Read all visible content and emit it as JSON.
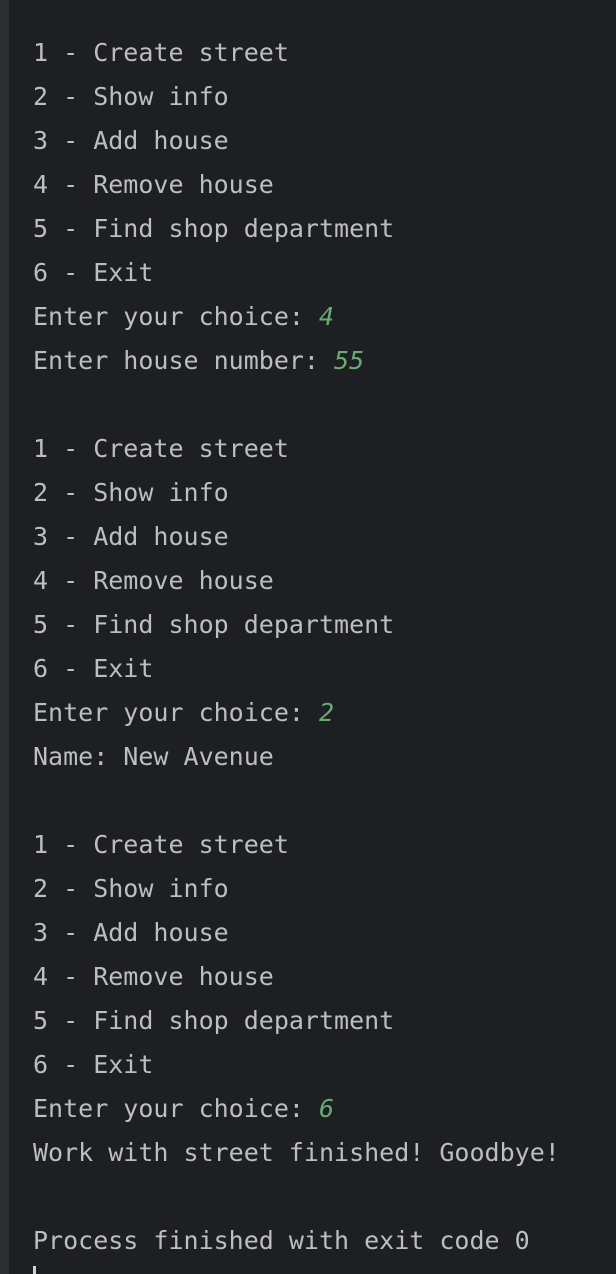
{
  "console": {
    "lines": [
      {
        "text": "1 - Create street"
      },
      {
        "text": "2 - Show info"
      },
      {
        "text": "3 - Add house"
      },
      {
        "text": "4 - Remove house"
      },
      {
        "text": "5 - Find shop department"
      },
      {
        "text": "6 - Exit"
      },
      {
        "text": "Enter your choice: ",
        "input": "4"
      },
      {
        "text": "Enter house number: ",
        "input": "55"
      },
      {
        "text": ""
      },
      {
        "text": "1 - Create street"
      },
      {
        "text": "2 - Show info"
      },
      {
        "text": "3 - Add house"
      },
      {
        "text": "4 - Remove house"
      },
      {
        "text": "5 - Find shop department"
      },
      {
        "text": "6 - Exit"
      },
      {
        "text": "Enter your choice: ",
        "input": "2"
      },
      {
        "text": "Name: New Avenue"
      },
      {
        "text": ""
      },
      {
        "text": "1 - Create street"
      },
      {
        "text": "2 - Show info"
      },
      {
        "text": "3 - Add house"
      },
      {
        "text": "4 - Remove house"
      },
      {
        "text": "5 - Find shop department"
      },
      {
        "text": "6 - Exit"
      },
      {
        "text": "Enter your choice: ",
        "input": "6"
      },
      {
        "text": "Work with street finished! Goodbye!"
      },
      {
        "text": ""
      },
      {
        "text": "Process finished with exit code 0"
      }
    ]
  },
  "colors": {
    "background": "#1e1f22",
    "gutter": "#2b2d30",
    "text": "#bcbec4",
    "user_input": "#6aab73"
  }
}
